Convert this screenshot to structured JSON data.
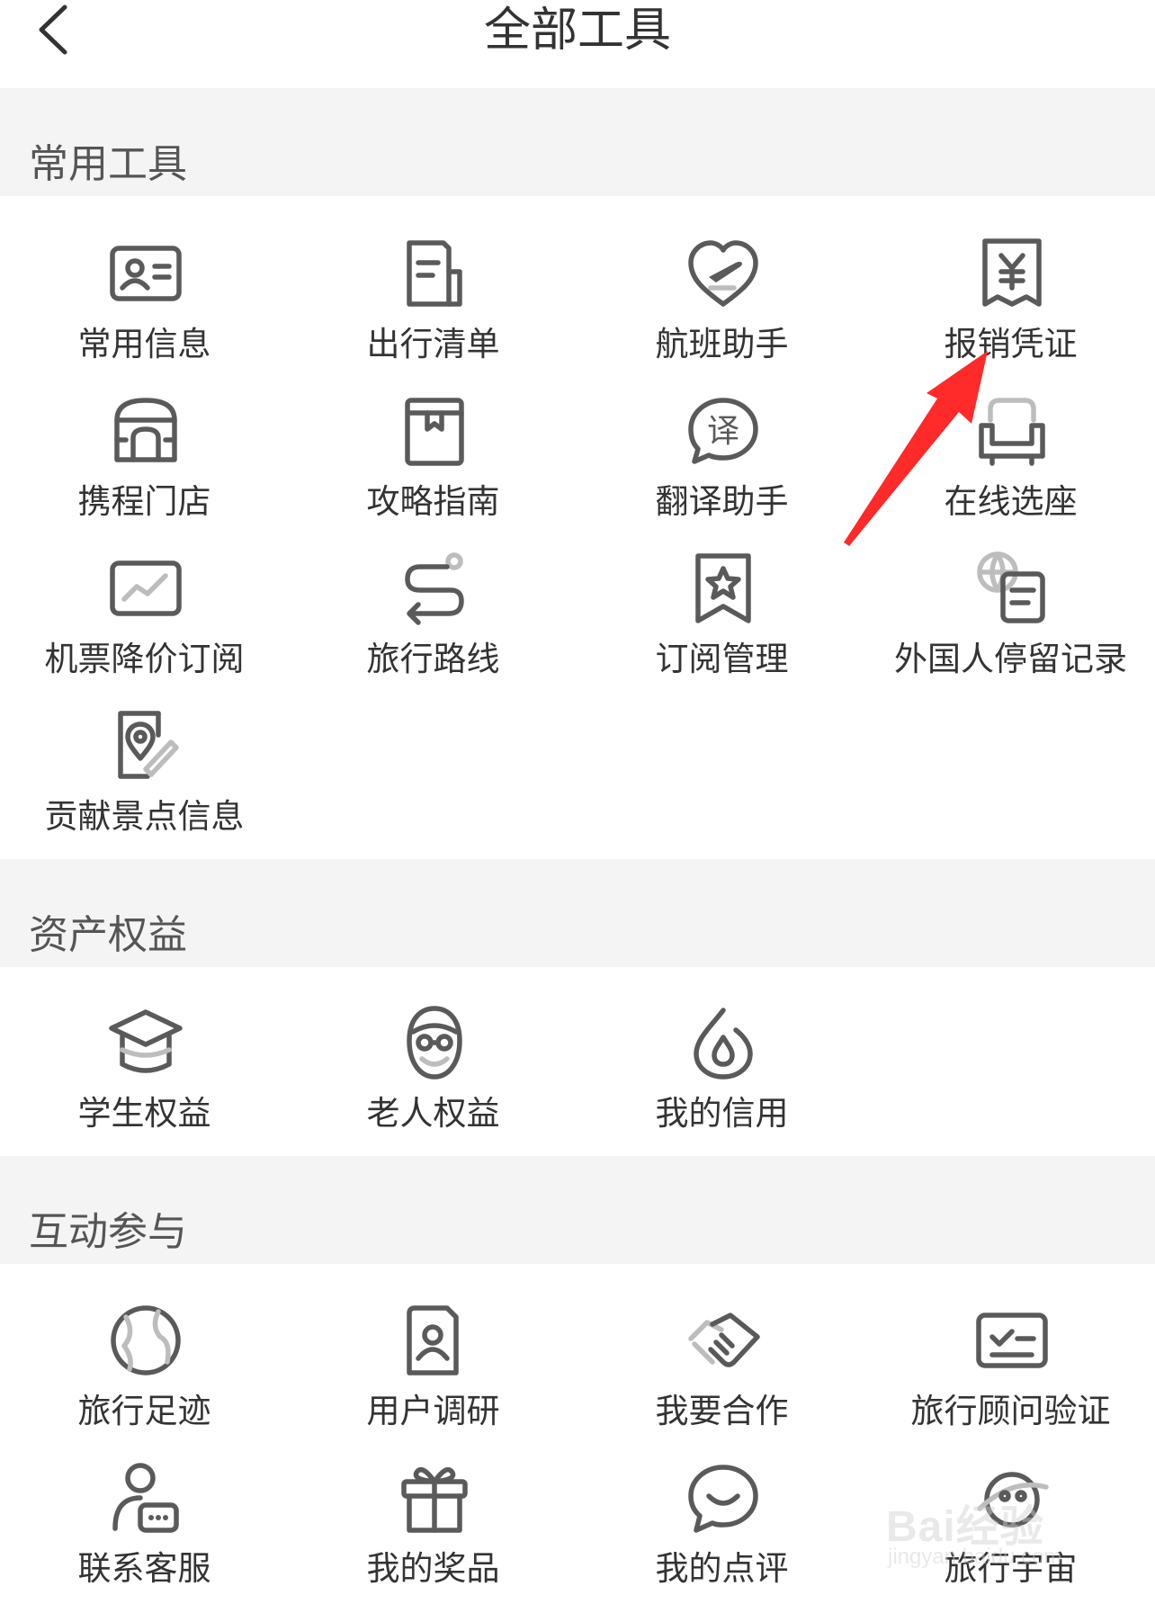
{
  "header": {
    "title": "全部工具"
  },
  "sections": [
    {
      "title": "常用工具",
      "items": [
        {
          "label": "常用信息",
          "icon": "id-card-icon"
        },
        {
          "label": "出行清单",
          "icon": "checklist-icon"
        },
        {
          "label": "航班助手",
          "icon": "flight-heart-icon"
        },
        {
          "label": "报销凭证",
          "icon": "receipt-yuan-icon"
        },
        {
          "label": "携程门店",
          "icon": "store-icon"
        },
        {
          "label": "攻略指南",
          "icon": "guide-book-icon"
        },
        {
          "label": "翻译助手",
          "icon": "translate-bubble-icon"
        },
        {
          "label": "在线选座",
          "icon": "seat-icon"
        },
        {
          "label": "机票降价订阅",
          "icon": "price-chart-icon"
        },
        {
          "label": "旅行路线",
          "icon": "route-icon"
        },
        {
          "label": "订阅管理",
          "icon": "bookmark-star-icon"
        },
        {
          "label": "外国人停留记录",
          "icon": "globe-document-icon"
        },
        {
          "label": "贡献景点信息",
          "icon": "map-pin-edit-icon"
        }
      ]
    },
    {
      "title": "资产权益",
      "items": [
        {
          "label": "学生权益",
          "icon": "graduation-cap-icon"
        },
        {
          "label": "老人权益",
          "icon": "elder-face-icon"
        },
        {
          "label": "我的信用",
          "icon": "credit-drop-icon"
        }
      ]
    },
    {
      "title": "互动参与",
      "items": [
        {
          "label": "旅行足迹",
          "icon": "globe-icon"
        },
        {
          "label": "用户调研",
          "icon": "survey-user-icon"
        },
        {
          "label": "我要合作",
          "icon": "handshake-icon"
        },
        {
          "label": "旅行顾问验证",
          "icon": "verify-card-icon"
        },
        {
          "label": "联系客服",
          "icon": "customer-service-icon"
        },
        {
          "label": "我的奖品",
          "icon": "gift-icon"
        },
        {
          "label": "我的点评",
          "icon": "review-bubble-icon"
        },
        {
          "label": "旅行宇宙",
          "icon": "travel-universe-icon"
        }
      ]
    }
  ],
  "watermark": {
    "text": "Bai经验",
    "sub": "jingyan.baidu.com"
  },
  "colors": {
    "icon": "#5a5a5a",
    "section_bg": "#f4f4f4",
    "arrow": "#ff2a2a"
  }
}
